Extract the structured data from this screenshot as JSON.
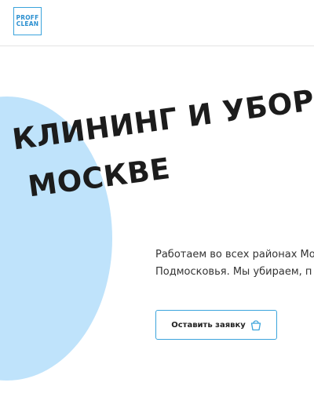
{
  "header": {
    "logo": {
      "line1": "PROFF",
      "line2": "CLEAN"
    }
  },
  "hero": {
    "title_line1": "КЛИНИНГ И УБОРКА",
    "title_line2": "МОСКВЕ",
    "description_line1": "Работаем во всех районах Мо",
    "description_line2": "Подмосковья. Мы убираем, п",
    "cta_label": "Оставить заявку",
    "cta_icon": "bucket-icon"
  },
  "colors": {
    "accent": "#3ba4dc",
    "circle": "#bfe3fb",
    "title": "#1c1c1c"
  }
}
